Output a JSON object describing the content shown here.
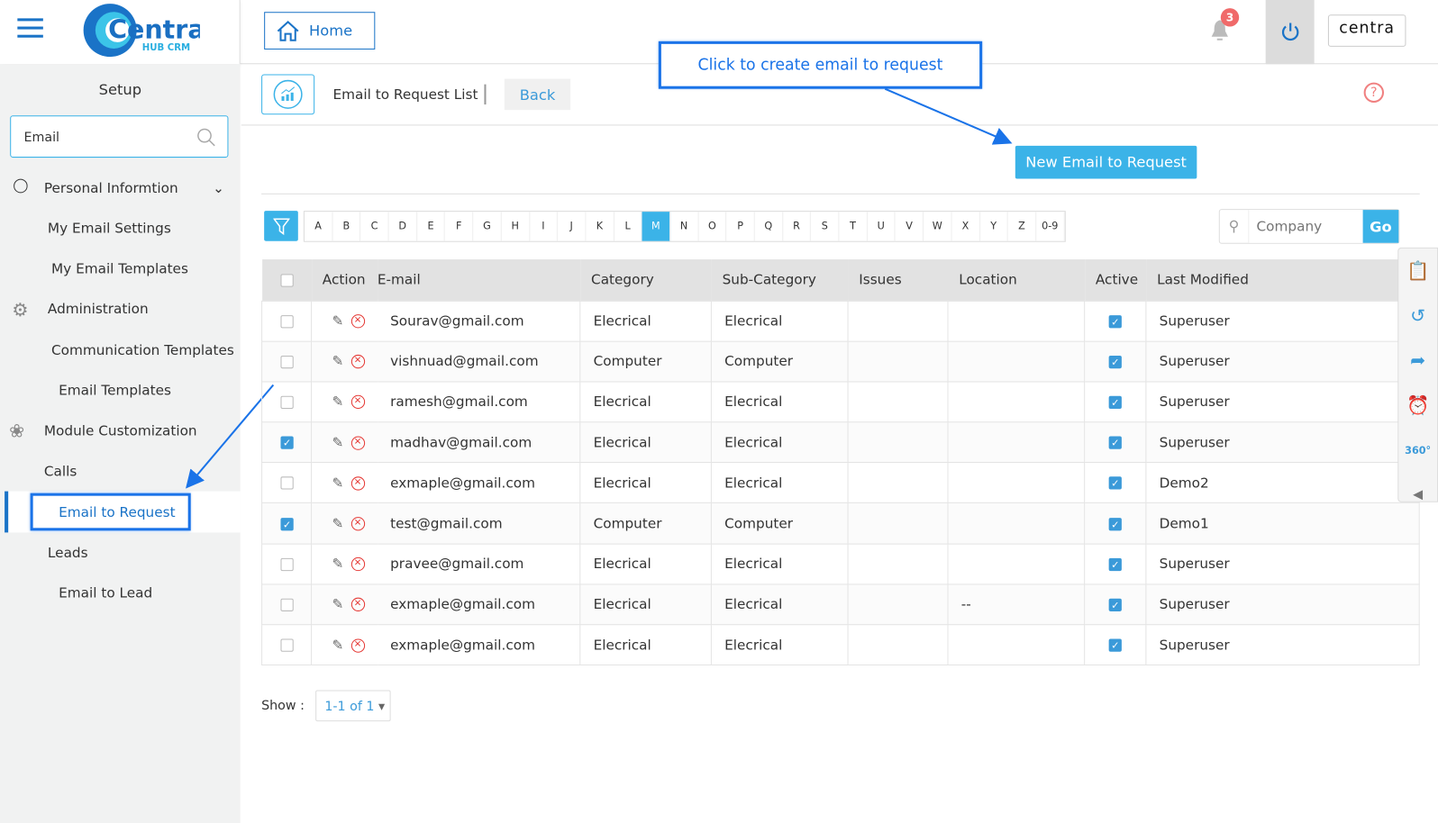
{
  "header": {
    "logo_text": "Centra",
    "logo_sub": "HUB CRM",
    "home": "Home",
    "notification_count": "3",
    "brand": "centra"
  },
  "sidebar": {
    "title": "Setup",
    "search_value": "Email",
    "items": [
      {
        "label": "Personal Informtion",
        "icon": "user-icon"
      },
      {
        "label": "My Email Settings"
      },
      {
        "label": "My Email Templates"
      },
      {
        "label": "Administration",
        "icon": "gear-icon"
      },
      {
        "label": "Communication Templates"
      },
      {
        "label": "Email Templates"
      },
      {
        "label": "Module Customization",
        "icon": "puzzle-icon"
      },
      {
        "label": "Calls"
      },
      {
        "label": "Email to Request",
        "selected": true
      },
      {
        "label": "Leads"
      },
      {
        "label": "Email to Lead"
      }
    ]
  },
  "page": {
    "title": "Email to Request List",
    "back": "Back",
    "callout": "Click to create email to request",
    "new_button": "New Email to Request"
  },
  "alphabet": [
    "A",
    "B",
    "C",
    "D",
    "E",
    "F",
    "G",
    "H",
    "I",
    "J",
    "K",
    "L",
    "M",
    "N",
    "O",
    "P",
    "Q",
    "R",
    "S",
    "T",
    "U",
    "V",
    "W",
    "X",
    "Y",
    "Z",
    "0-9"
  ],
  "active_letter": "M",
  "company_search": {
    "placeholder": "Company",
    "go": "Go"
  },
  "table": {
    "headers": [
      "Action",
      "E-mail",
      "Category",
      "Sub-Category",
      "Issues",
      "Location",
      "Active",
      "Last Modified"
    ],
    "rows": [
      {
        "checked": false,
        "email": "Sourav@gmail.com",
        "category": "Elecrical",
        "sub": "Elecrical",
        "issues": "",
        "location": "",
        "active": true,
        "modified": "Superuser"
      },
      {
        "checked": false,
        "email": "vishnuad@gmail.com",
        "category": "Computer",
        "sub": "Computer",
        "issues": "",
        "location": "",
        "active": true,
        "modified": "Superuser"
      },
      {
        "checked": false,
        "email": "ramesh@gmail.com",
        "category": "Elecrical",
        "sub": "Elecrical",
        "issues": "",
        "location": "",
        "active": true,
        "modified": "Superuser"
      },
      {
        "checked": true,
        "email": "madhav@gmail.com",
        "category": "Elecrical",
        "sub": "Elecrical",
        "issues": "",
        "location": "",
        "active": true,
        "modified": "Superuser"
      },
      {
        "checked": false,
        "email": "exmaple@gmail.com",
        "category": "Elecrical",
        "sub": "Elecrical",
        "issues": "",
        "location": "",
        "active": true,
        "modified": "Demo2"
      },
      {
        "checked": true,
        "email": "test@gmail.com",
        "category": "Computer",
        "sub": "Computer",
        "issues": "",
        "location": "",
        "active": true,
        "modified": "Demo1"
      },
      {
        "checked": false,
        "email": "pravee@gmail.com",
        "category": "Elecrical",
        "sub": "Elecrical",
        "issues": "",
        "location": "",
        "active": true,
        "modified": "Superuser"
      },
      {
        "checked": false,
        "email": "exmaple@gmail.com",
        "category": "Elecrical",
        "sub": "Elecrical",
        "issues": "",
        "location": "--",
        "active": true,
        "modified": "Superuser"
      },
      {
        "checked": false,
        "email": "exmaple@gmail.com",
        "category": "Elecrical",
        "sub": "Elecrical",
        "issues": "",
        "location": "",
        "active": true,
        "modified": "Superuser"
      }
    ]
  },
  "footer": {
    "show_label": "Show :",
    "pager": "1-1 of 1"
  }
}
